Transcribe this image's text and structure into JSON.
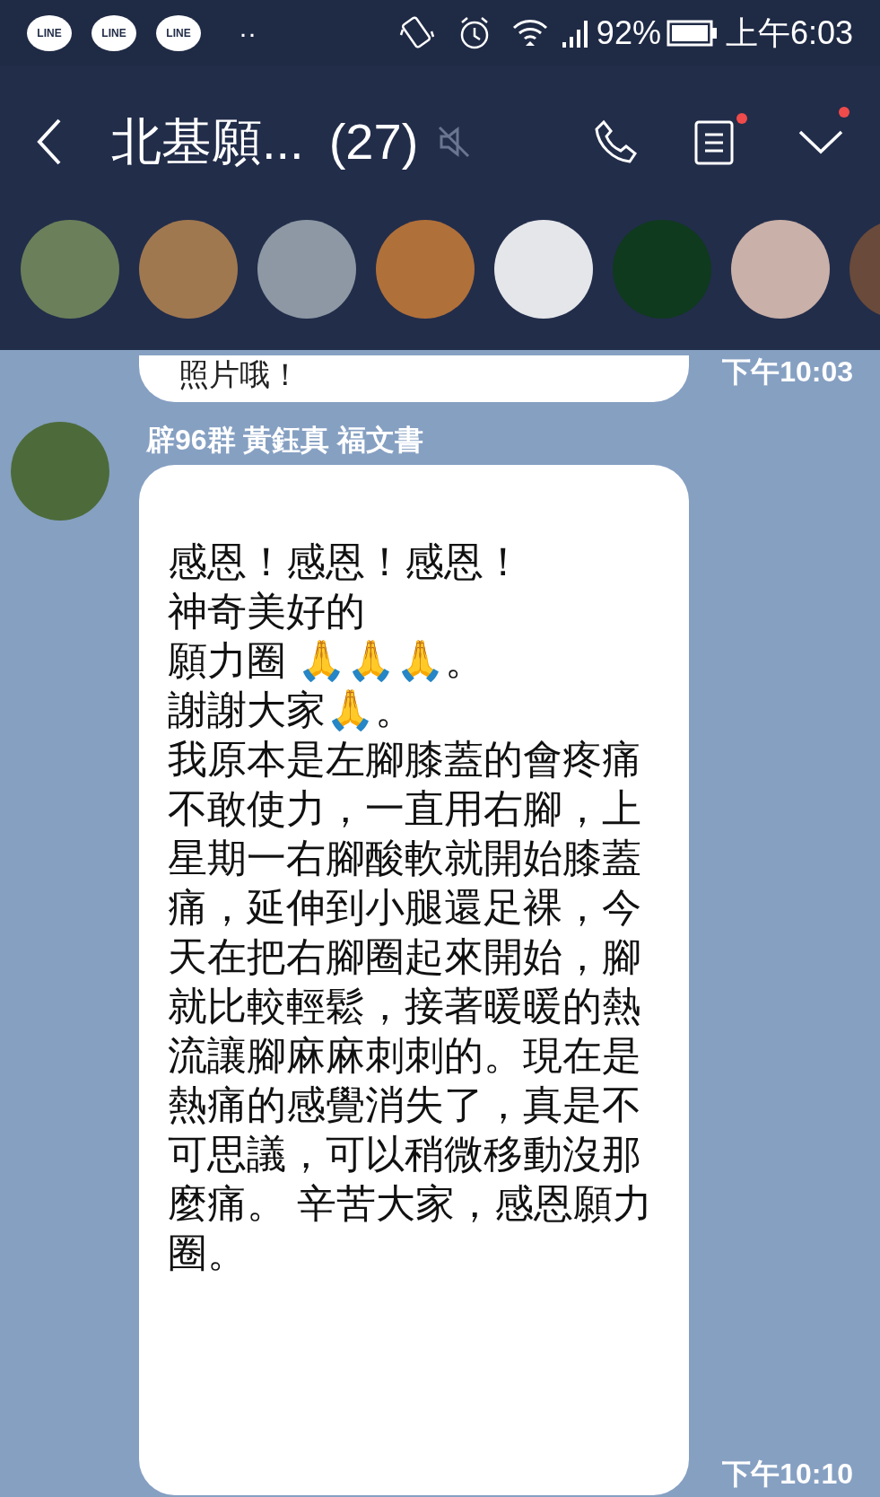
{
  "status_bar": {
    "notifications": [
      {
        "kind": "app",
        "label": "LINE"
      },
      {
        "kind": "app",
        "label": "LINE"
      },
      {
        "kind": "app",
        "label": "LINE"
      }
    ],
    "more": "··",
    "battery": "92%",
    "time": "上午6:03"
  },
  "header": {
    "title": "北基願...",
    "member_count": "(27)",
    "muted": true,
    "notes_badge": true,
    "menu_badge": true
  },
  "member_avatars": [
    {
      "color": "#6b7f5a"
    },
    {
      "color": "#a07850"
    },
    {
      "color": "#8d98a4"
    },
    {
      "color": "#b0703a"
    },
    {
      "color": "#e4e6ea"
    },
    {
      "color": "#0f3a1e"
    },
    {
      "color": "#c9b0a8"
    },
    {
      "color": "#6a4a3a"
    }
  ],
  "messages": [
    {
      "kind": "continued",
      "text": "照片哦！",
      "time": "下午10:03"
    },
    {
      "kind": "with_sender",
      "sender": "辟96群 黃鈺真 福文書",
      "lines": [
        "感恩！感恩！感恩！",
        "神奇美好的",
        "願力圈 🙏🙏🙏。",
        "謝謝大家🙏。",
        "我原本是左腳膝蓋的會疼痛不敢使力，一直用右腳，上星期一右腳酸軟就開始膝蓋痛，延伸到小腿還足裸，今天在把右腳圈起來開始，腳就比較輕鬆，接著暖暖的熱流讓腳麻麻刺刺的。現在是熱痛的感覺消失了，真是不可思議，可以稍微移動沒那麼痛。 辛苦大家，感恩願力圈。"
      ],
      "time": "下午10:10"
    }
  ]
}
